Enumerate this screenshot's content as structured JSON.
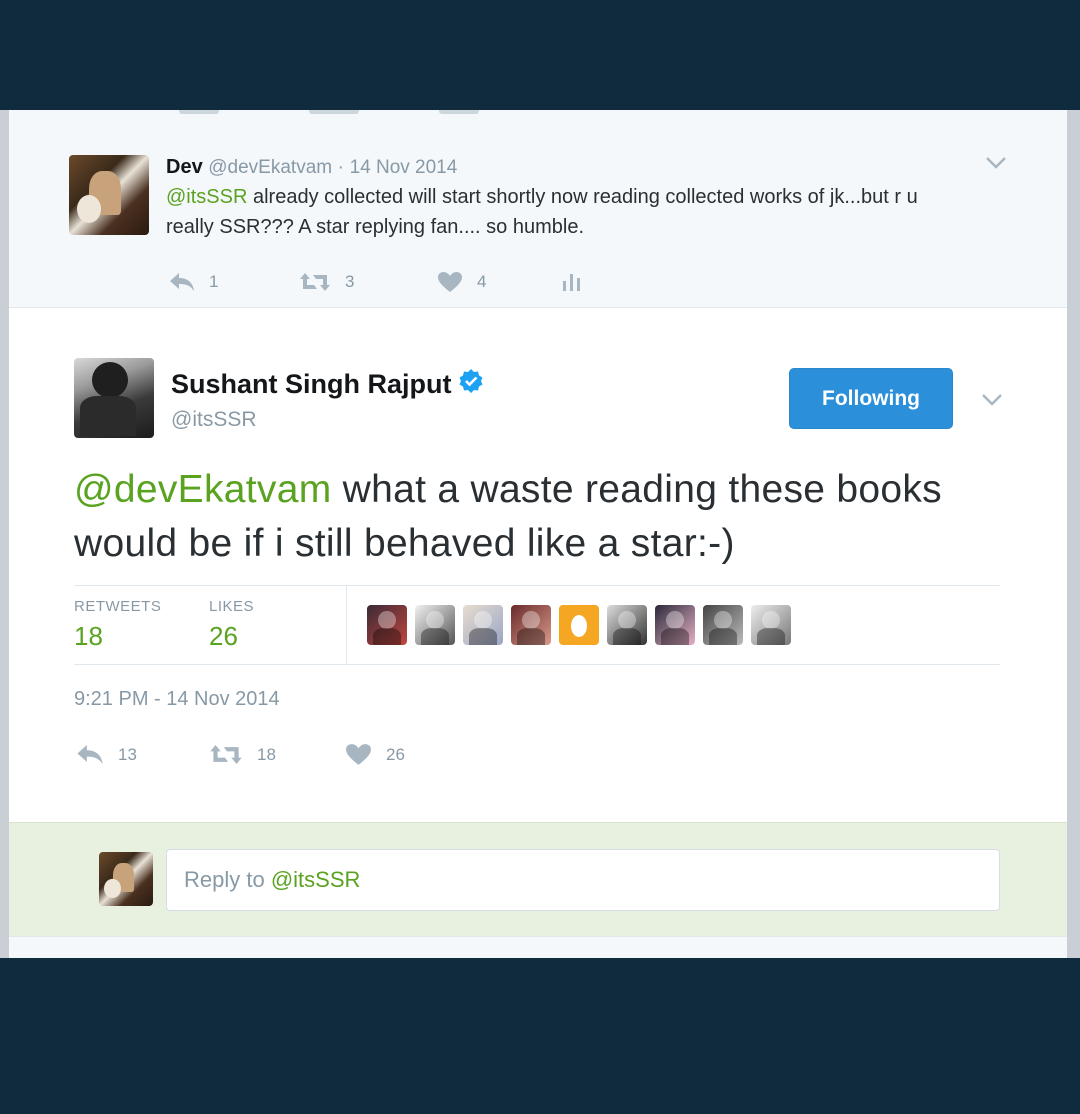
{
  "colors": {
    "accent_green": "#5aa321",
    "follow_blue": "#2b90d9",
    "muted": "#8899a6",
    "background": "#102a3e"
  },
  "reply_tweet": {
    "author_name": "Dev",
    "handle": "@devEkatvam",
    "separator": "·",
    "date": "14 Nov 2014",
    "mention": "@itsSSR",
    "text": " already collected will start shortly now reading collected works of jk...but r u really SSR??? A star replying fan.... so humble.",
    "reply_count": "1",
    "retweet_count": "3",
    "like_count": "4",
    "icons": [
      "reply-icon",
      "retweet-icon",
      "heart-icon",
      "analytics-icon",
      "chevron-down-icon"
    ]
  },
  "main_tweet": {
    "author_name": "Sushant Singh Rajput",
    "verified": true,
    "handle": "@itsSSR",
    "follow_label": "Following",
    "mention": "@devEkatvam",
    "text": " what a waste reading these books would be if i still behaved like a star:-)",
    "retweets_label": "RETWEETS",
    "retweets_count": "18",
    "likes_label": "LIKES",
    "likes_count": "26",
    "liker_avatars": 9,
    "timestamp": "9:21 PM - 14 Nov 2014",
    "reply_count": "13",
    "retweet_count": "18",
    "like_count": "26"
  },
  "reply_box": {
    "placeholder_prefix": "Reply to ",
    "placeholder_mention": "@itsSSR"
  }
}
